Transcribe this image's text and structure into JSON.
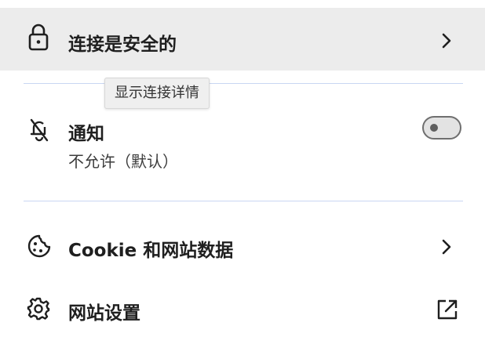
{
  "connection": {
    "label": "连接是安全的",
    "icon": "lock-icon",
    "tooltip": "显示连接详情"
  },
  "notifications": {
    "label": "通知",
    "status": "不允许（默认）",
    "icon": "notifications-off-icon",
    "toggle_on": false
  },
  "cookies": {
    "label": "Cookie 和网站数据",
    "icon": "cookie-icon"
  },
  "site_settings": {
    "label": "网站设置",
    "icon": "gear-icon"
  },
  "colors": {
    "highlight_row": "#ececec",
    "divider": "#c9d6f2",
    "text": "#1f1f1f"
  }
}
